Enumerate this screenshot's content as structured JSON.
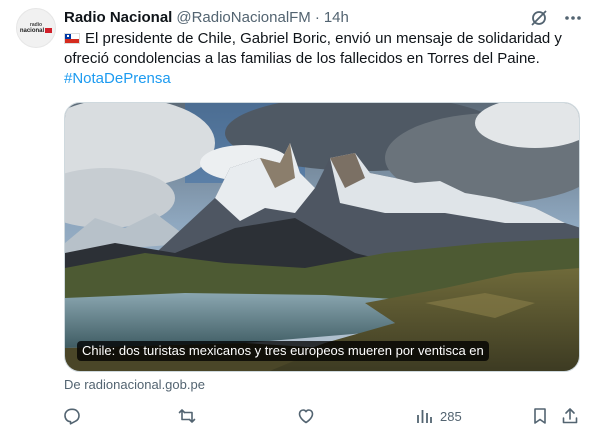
{
  "author": {
    "name": "Radio Nacional",
    "handle": "@RadioNacionalFM",
    "separator": "·",
    "time": "14h",
    "avatar_text_top": "radio",
    "avatar_text_main": "nacional"
  },
  "header_icons": [
    "grok-icon",
    "more-icon"
  ],
  "tweet": {
    "text": "El presidente de Chile, Gabriel Boric, envió un mensaje de solidaridad y ofreció condolencias a las familias de los fallecidos en Torres del Paine.",
    "hashtag": "#NotaDePrensa",
    "flag": "chile-flag-icon"
  },
  "card": {
    "caption": "Chile: dos turistas mexicanos y tres europeos mueren por ventisca en",
    "source": "De radionacional.gob.pe"
  },
  "actions": {
    "views": "285",
    "icons": [
      "reply-icon",
      "retweet-icon",
      "like-icon",
      "views-icon",
      "bookmark-icon",
      "share-icon"
    ]
  },
  "colors": {
    "accent": "#1d9bf0",
    "muted": "#536471",
    "text": "#0f1419"
  }
}
